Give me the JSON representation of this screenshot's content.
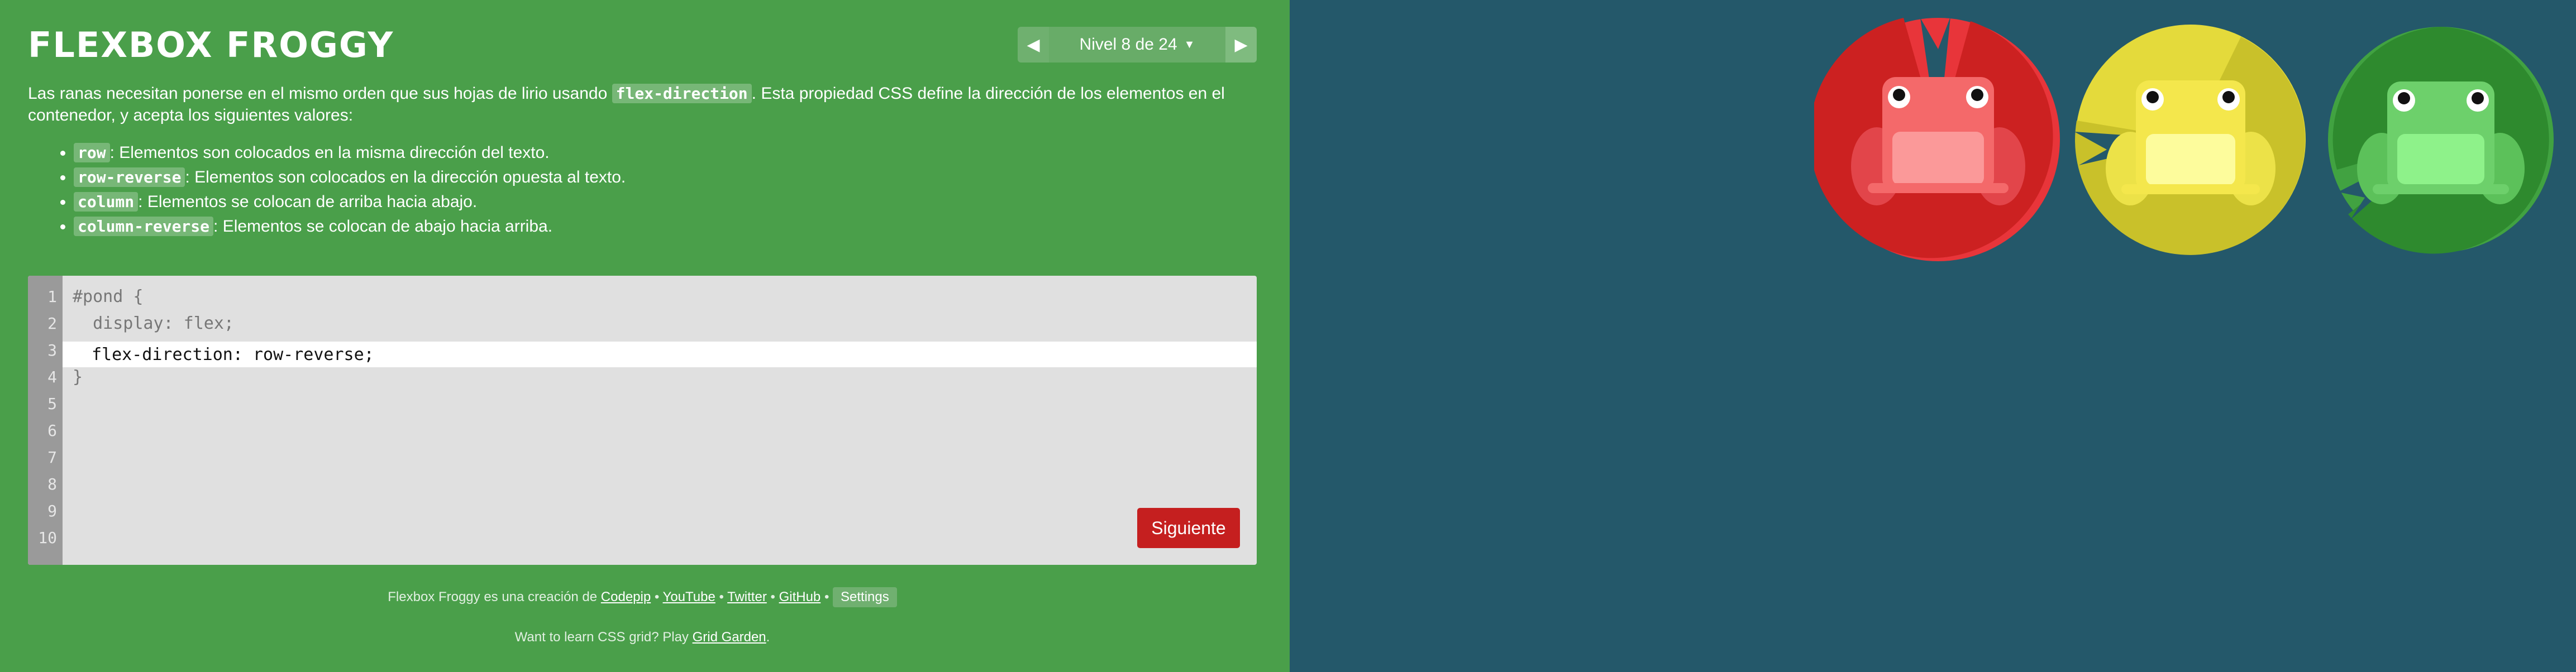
{
  "sidebar": {
    "title": "FLEXBOX FROGGY",
    "level_label": "Nivel 8 de 24",
    "intro_before": "Las ranas necesitan ponerse en el mismo orden que sus hojas de lirio usando ",
    "intro_code": "flex-direction",
    "intro_after": ". Esta propiedad CSS define la dirección de los elementos en el contenedor, y acepta los siguientes valores:",
    "values": [
      {
        "code": "row",
        "text": ": Elementos son colocados en la misma dirección del texto."
      },
      {
        "code": "row-reverse",
        "text": ": Elementos son colocados en la dirección opuesta al texto."
      },
      {
        "code": "column",
        "text": ": Elementos se colocan de arriba hacia abajo."
      },
      {
        "code": "column-reverse",
        "text": ": Elementos se colocan de abajo hacia arriba."
      }
    ]
  },
  "editor": {
    "line_numbers": [
      "1",
      "2",
      "3",
      "4",
      "5",
      "6",
      "7",
      "8",
      "9",
      "10"
    ],
    "line1": "#pond {",
    "line2": "  display: flex;",
    "input_value": "flex-direction: row-reverse;",
    "line4": "}",
    "next_button": "Siguiente"
  },
  "footer": {
    "credit_prefix": "Flexbox Froggy es una creación de ",
    "codepip": "Codepip",
    "youtube": "YouTube",
    "twitter": "Twitter",
    "github": "GitHub",
    "settings": "Settings",
    "separator": " • ",
    "learn_prefix": "Want to learn CSS grid? Play ",
    "grid_garden": "Grid Garden",
    "learn_suffix": "."
  },
  "pond": {
    "frogs": [
      {
        "color": "red",
        "body": "#f4696a",
        "pad": "#cc2121",
        "pad_shadow": "#e8353a"
      },
      {
        "color": "yellow",
        "body": "#f4e74c",
        "pad": "#c9c12a",
        "pad_shadow": "#e4da3b"
      },
      {
        "color": "green",
        "body": "#6dd06b",
        "pad": "#2e8a2e",
        "pad_shadow": "#41a241"
      }
    ]
  },
  "colors": {
    "sidebar_bg": "#4a9f4a",
    "pond_bg": "#24586a",
    "next_button": "#c51f1f"
  }
}
